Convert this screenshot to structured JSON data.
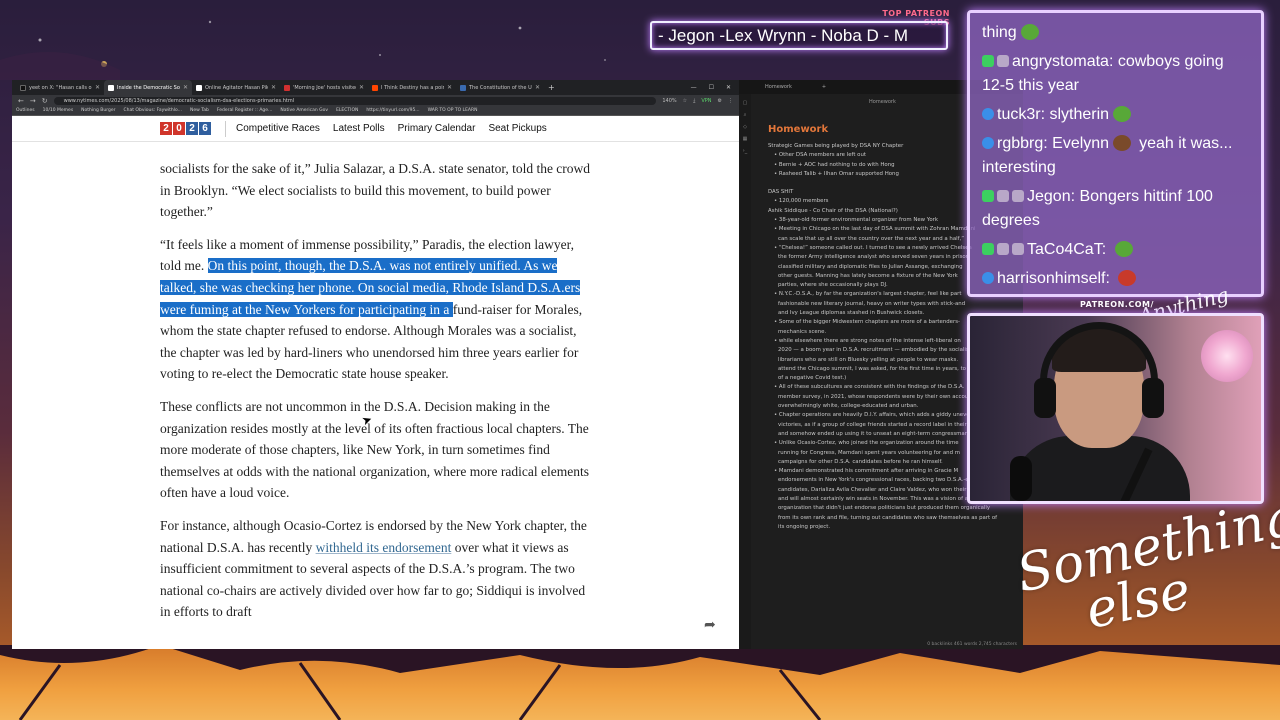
{
  "stream": {
    "subs_label": "TOP PATREON SUBS",
    "subs_names": "- Jegon -Lex Wrynn -  Noba D - M",
    "patreon_url": "PATREON.COM/",
    "logo_small": "Anything else?",
    "logo_big_1": "Something",
    "logo_big_2": "else"
  },
  "browser": {
    "tabs": [
      {
        "label": "yeet on X: \"Hasan calls out the"
      },
      {
        "label": "Inside the Democratic Socialist"
      },
      {
        "label": "Online Agitator Hasan Piker Is P"
      },
      {
        "label": "'Morning Joe' hosts visited Ma"
      },
      {
        "label": "I Think Destiny has a point abo"
      },
      {
        "label": "The Constitution of the United"
      }
    ],
    "active_tab": 1,
    "url": "www.nytimes.com/2025/08/13/magazine/democratic-socialism-dsa-elections-primaries.html",
    "zoom": "140%",
    "vpn": "VPN",
    "bookmarks": [
      "Outlines",
      "10/10 Memes",
      "Nothing Burger",
      "Chat Obvious: Faywithlo...",
      "New Tab",
      "Federal Register :: Age...",
      "Native American Gov",
      "ELECTION",
      "https://tinyurl.com/95...",
      "WAR TO OP TO LEARN"
    ]
  },
  "site_nav": {
    "logo_digits": [
      "2",
      "0",
      "2",
      "6"
    ],
    "links": [
      "Competitive Races",
      "Latest Polls",
      "Primary Calendar",
      "Seat Pickups"
    ]
  },
  "article": {
    "p1": "socialists for the sake of it,” Julia Salazar, a D.S.A. state senator, told the crowd in Brooklyn. “We elect socialists to build this movement, to build power together.”",
    "p2_start": "“It feels like a moment of immense possibility,” Paradis, the election lawyer, told me. ",
    "p2_highlight": "On this point, though, the D.S.A. was not entirely unified. As we talked, she was checking her phone. On social media, Rhode Island D.S.A.ers were fuming at the New Yorkers for participating in a ",
    "p2_end": "fund-raiser for Morales, whom the state chapter refused to endorse. Although Morales was a socialist, the chapter was led by hard-liners who unendorsed him three years earlier for voting to re-elect the Democratic state house speaker.",
    "p3": "These conflicts are not uncommon in the D.S.A. Decision making in the organization resides mostly at the level of its often fractious local chapters. The more moderate of those chapters, like New York, in turn sometimes find themselves at odds with the national organization, where more radical elements often have a loud voice.",
    "p4_start": "For instance, although Ocasio-Cortez is endorsed by the New York chapter, the national D.S.A. has recently ",
    "p4_link": "withheld its endorsement",
    "p4_end": " over what it views as insufficient commitment to several aspects of the D.S.A.’s program. The two national co-chairs are actively divided over how far to go; Siddiqui is involved in efforts to draft"
  },
  "notes": {
    "tab_label": "Homework",
    "file_label": "Homework",
    "title": "Homework",
    "sections": [
      {
        "cls": "",
        "text": "Strategic Games being played by DSA NY Chapter"
      },
      {
        "cls": "ind",
        "text": "• Other DSA members are left out"
      },
      {
        "cls": "ind",
        "text": "• Bernie + AOC had nothing to do with Hong"
      },
      {
        "cls": "ind",
        "text": "• Rasheed Talib + Ilhan Omar supported Hong"
      },
      {
        "cls": "gap",
        "text": ""
      },
      {
        "cls": "",
        "text": "DAS SHIT"
      },
      {
        "cls": "ind",
        "text": "• 120,000 members"
      },
      {
        "cls": "",
        "text": "Ashik Siddique - Co Chair of the DSA (National?)"
      },
      {
        "cls": "ind",
        "text": "• 38-year-old former environmental organizer from New York"
      },
      {
        "cls": "ind",
        "text": "• Meeting in Chicago on the last day of DSA summit with Zohran Mamdani"
      },
      {
        "cls": "ind2",
        "text": "can scale that up all over the country over the next year and a half,”"
      },
      {
        "cls": "ind",
        "text": "• “Chelsea!” someone called out. I turned to see a newly arrived Chelsea"
      },
      {
        "cls": "ind2",
        "text": "the former Army intelligence analyst who served seven years in prison"
      },
      {
        "cls": "ind2",
        "text": "classified military and diplomatic files to Julian Assange, exchanging"
      },
      {
        "cls": "ind2",
        "text": "other guests. Manning has lately become a fixture of the New York"
      },
      {
        "cls": "ind2",
        "text": "parties, where she occasionally plays DJ."
      },
      {
        "cls": "ind",
        "text": "• N.Y.C.-D.S.A., by far the organization's largest chapter, feel like part"
      },
      {
        "cls": "ind2",
        "text": "fashionable new literary journal, heavy on writer types with stick-and"
      },
      {
        "cls": "ind2",
        "text": "and Ivy League diplomas stashed in Bushwick closets."
      },
      {
        "cls": "ind",
        "text": "• Some of the bigger Midwestern chapters are more of a bartenders-"
      },
      {
        "cls": "ind2",
        "text": "mechanics scene."
      },
      {
        "cls": "ind",
        "text": "• while elsewhere there are strong notes of the intense left-liberal on"
      },
      {
        "cls": "ind2",
        "text": "2020 — a boom year in D.S.A. recruitment — embodied by the socialist"
      },
      {
        "cls": "ind2",
        "text": "librarians who are still on Bluesky yelling at people to wear masks."
      },
      {
        "cls": "ind2",
        "text": "attend the Chicago summit, I was asked, for the first time in years, to"
      },
      {
        "cls": "ind2",
        "text": "of a negative Covid test.)"
      },
      {
        "cls": "ind",
        "text": "• All of these subcultures are consistent with the findings of the D.S.A."
      },
      {
        "cls": "ind2",
        "text": "member survey, in 2021, whose respondents were by their own account"
      },
      {
        "cls": "ind2",
        "text": "overwhelmingly white, college-educated and urban."
      },
      {
        "cls": "ind",
        "text": "• Chapter operations are heavily D.I.Y. affairs, which adds a giddy unevenness"
      },
      {
        "cls": "ind2",
        "text": "victories, as if a group of college friends started a record label in their"
      },
      {
        "cls": "ind2",
        "text": "and somehow ended up using it to unseat an eight-term congressman"
      },
      {
        "cls": "ind",
        "text": "• Unlike Ocasio-Cortez, who joined the organization around the time"
      },
      {
        "cls": "ind2",
        "text": "running for Congress, Mamdani spent years volunteering for and m"
      },
      {
        "cls": "ind2",
        "text": "campaigns for other D.S.A. candidates before he ran himself."
      },
      {
        "cls": "ind",
        "text": "• Mamdani demonstrated his commitment after arriving in Gracie M"
      },
      {
        "cls": "ind2",
        "text": "endorsements in New York's congressional races, backing two D.S.A.-endorsed"
      },
      {
        "cls": "ind2",
        "text": "candidates, Darializa Avila Chevalier and Claire Valdez, who won their primaries"
      },
      {
        "cls": "ind2",
        "text": "and will almost certainly win seats in November. This was a vision of an"
      },
      {
        "cls": "ind2",
        "text": "organization that didn't just endorse politicians but produced them organically"
      },
      {
        "cls": "ind2",
        "text": "from its own rank and file, turning out candidates who saw themselves as part of"
      },
      {
        "cls": "ind2",
        "text": "its ongoing project."
      }
    ],
    "status": "0 backlinks   461 words   2,745 characters"
  },
  "chat": [
    {
      "badges": [],
      "name": "",
      "msg": "thing",
      "emote": "frog"
    },
    {
      "badges": [
        "green",
        "icon"
      ],
      "name": "angrystomata",
      "msg": "cowboys going 12-5 this year",
      "emote": ""
    },
    {
      "badges": [
        "circ"
      ],
      "name": "tuck3r",
      "msg": "slytherin",
      "emote": "frog"
    },
    {
      "badges": [
        "circ"
      ],
      "name": "rgbbrg",
      "msg": "Evelynn",
      "emote": "face",
      "msg2": "yeah it was... interesting"
    },
    {
      "badges": [
        "green",
        "icon",
        "icon"
      ],
      "name": "Jegon",
      "msg": "Bongers hittinf 100 degrees",
      "emote": ""
    },
    {
      "badges": [
        "green",
        "icon",
        "icon"
      ],
      "name": "TaCo4CaT",
      "msg": "",
      "emote": "frog"
    },
    {
      "badges": [
        "circ"
      ],
      "name": "harrisonhimself",
      "msg": "",
      "emote": "red"
    }
  ]
}
